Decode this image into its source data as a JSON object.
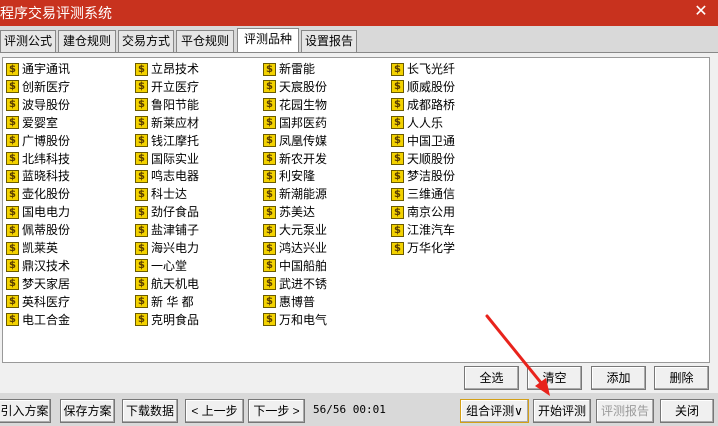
{
  "window": {
    "title": "程序交易评测系统",
    "close_symbol": "✕"
  },
  "tabs": [
    {
      "label": "评测公式",
      "active": false
    },
    {
      "label": "建仓规则",
      "active": false
    },
    {
      "label": "交易方式",
      "active": false
    },
    {
      "label": "平仓规则",
      "active": false
    },
    {
      "label": "评测品种",
      "active": true
    },
    {
      "label": "设置报告",
      "active": false
    }
  ],
  "item_icon": {
    "name": "dollar-icon",
    "glyph": "$",
    "fill": "#f3d200",
    "border": "#6a5a00"
  },
  "stock_columns": [
    [
      "通宇通讯",
      "创新医疗",
      "波导股份",
      "爱婴室",
      "广博股份",
      "北纬科技",
      "蓝晓科技",
      "壶化股份",
      "国电电力",
      "佩蒂股份",
      "凯莱英",
      "鼎汉技术",
      "梦天家居",
      "英科医疗",
      "电工合金"
    ],
    [
      "立昂技术",
      "开立医疗",
      "鲁阳节能",
      "新莱应材",
      "钱江摩托",
      "国际实业",
      "鸣志电器",
      "科士达",
      "劲仔食品",
      "盐津铺子",
      "海兴电力",
      "一心堂",
      "航天机电",
      "新 华 都",
      "克明食品"
    ],
    [
      "新雷能",
      "天宸股份",
      "花园生物",
      "国邦医药",
      "凤凰传媒",
      "新农开发",
      "利安隆",
      "新潮能源",
      "苏美达",
      "大元泵业",
      "鸿达兴业",
      "中国船舶",
      "武进不锈",
      "惠博普",
      "万和电气"
    ],
    [
      "长飞光纤",
      "顺威股份",
      "成都路桥",
      "人人乐",
      "中国卫通",
      "天顺股份",
      "梦洁股份",
      "三维通信",
      "南京公用",
      "江淮汽车",
      "万华化学"
    ]
  ],
  "panel_buttons": {
    "select_all": "全选",
    "clear": "清空",
    "add": "添加",
    "delete": "删除"
  },
  "bottom": {
    "import": "引入方案",
    "save": "保存方案",
    "download": "下载数据",
    "prev": "< 上一步",
    "next": "下一步 >",
    "status": "56/56 00:01",
    "combo": "组合评测∨",
    "start": "开始评测",
    "report": "评测报告",
    "close": "关闭"
  },
  "colors": {
    "titlebar": "#c8321e",
    "annotation_arrow": "#e8231c",
    "combo_border": "#d4a017"
  }
}
